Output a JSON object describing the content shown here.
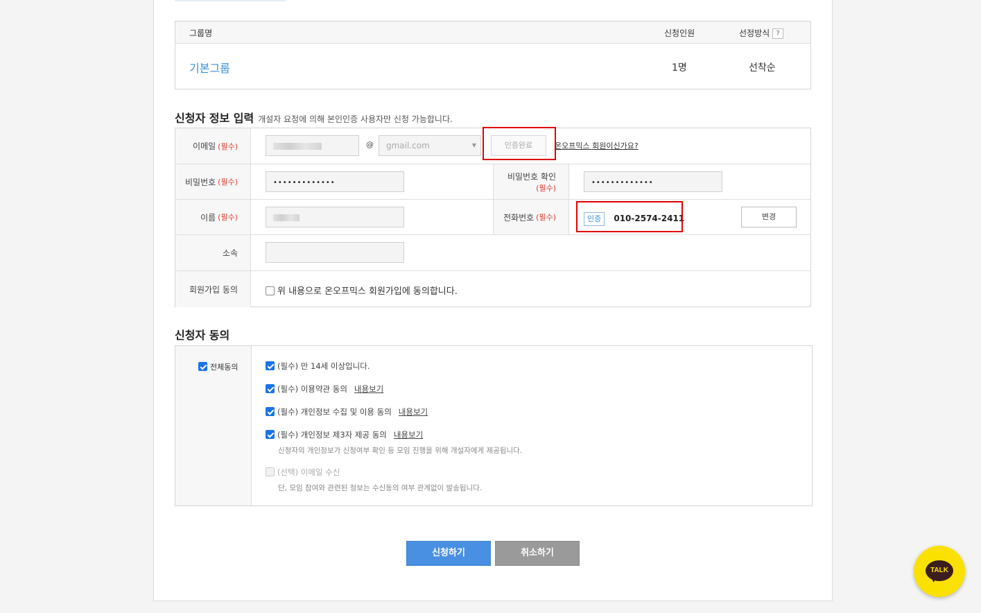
{
  "group_table": {
    "col_name": "그룹명",
    "col_count": "신청인원",
    "col_method": "선정방식",
    "help": "?",
    "row": {
      "name": "기본그룹",
      "count": "1명",
      "method": "선착순"
    }
  },
  "applicant": {
    "title": "신청자 정보 입력",
    "note": "개설자 요청에 의해 본인인증 사용자만 신청 가능합니다.",
    "required_mark": "(필수)",
    "email": {
      "label": "이메일",
      "at": "@",
      "domain": "gmail.com",
      "verify_button": "인증완료",
      "member_link": "온오프믹스 회원이신가요?"
    },
    "password": {
      "label": "비밀번호",
      "value": "•••••••••••••"
    },
    "password_confirm": {
      "label": "비밀번호 확인",
      "value": "•••••••••••••"
    },
    "name": {
      "label": "이름"
    },
    "phone": {
      "label": "전화번호",
      "badge": "인증",
      "value": "010-2574-2411",
      "change_button": "변경"
    },
    "affiliation": {
      "label": "소속",
      "value": ""
    },
    "signup": {
      "label": "회원가입 동의",
      "text": "위 내용으로 온오프믹스 회원가입에 동의합니다."
    }
  },
  "consent": {
    "title": "신청자 동의",
    "all": "전체동의",
    "items": [
      {
        "text": "(필수) 만 14세 이상입니다.",
        "checked": true
      },
      {
        "text": "(필수) 이용약관 동의",
        "view": "내용보기",
        "checked": true
      },
      {
        "text": "(필수) 개인정보 수집 및 이용 동의",
        "view": "내용보기",
        "checked": true
      },
      {
        "text": "(필수) 개인정보 제3자 제공 동의",
        "view": "내용보기",
        "checked": true,
        "sub": "신청자의 개인정보가 신청여부 확인 등 모임 진행을 위해 개설자에게 제공됩니다."
      },
      {
        "text": "(선택) 이메일 수신",
        "checked": false,
        "sub": "단, 모임 참여와 관련된 정보는 수신동의 여부 관계없이 발송됩니다."
      }
    ]
  },
  "actions": {
    "submit": "신청하기",
    "cancel": "취소하기"
  },
  "kakao": {
    "label": "TALK"
  },
  "colors": {
    "accent": "#4a90e2",
    "link_blue": "#3b8fd6",
    "required_red": "#e03c31",
    "highlight": "#e00000",
    "kakao": "#fae100"
  }
}
